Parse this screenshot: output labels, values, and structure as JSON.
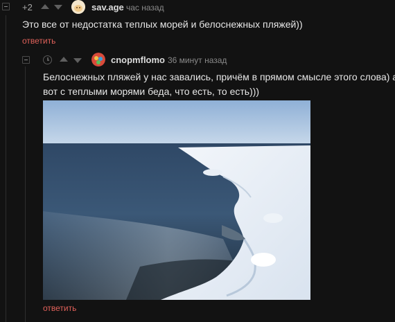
{
  "comment1": {
    "rating": "+2",
    "username": "sav.age",
    "time": "час назад",
    "text": "Это все от недостатка теплых морей и белоснежных пляжей))",
    "reply": "ответить"
  },
  "comment2": {
    "username": "cnopmflomo",
    "time": "36 минут назад",
    "text_line1": "Белоснежных пляжей у нас завались, причём в прямом смысле этого слова) а",
    "text_line2": "вот с теплыми морями беда, что есть, то есть)))",
    "reply": "ответить"
  },
  "colors": {
    "background": "#121212",
    "reply_link": "#e0615a"
  }
}
